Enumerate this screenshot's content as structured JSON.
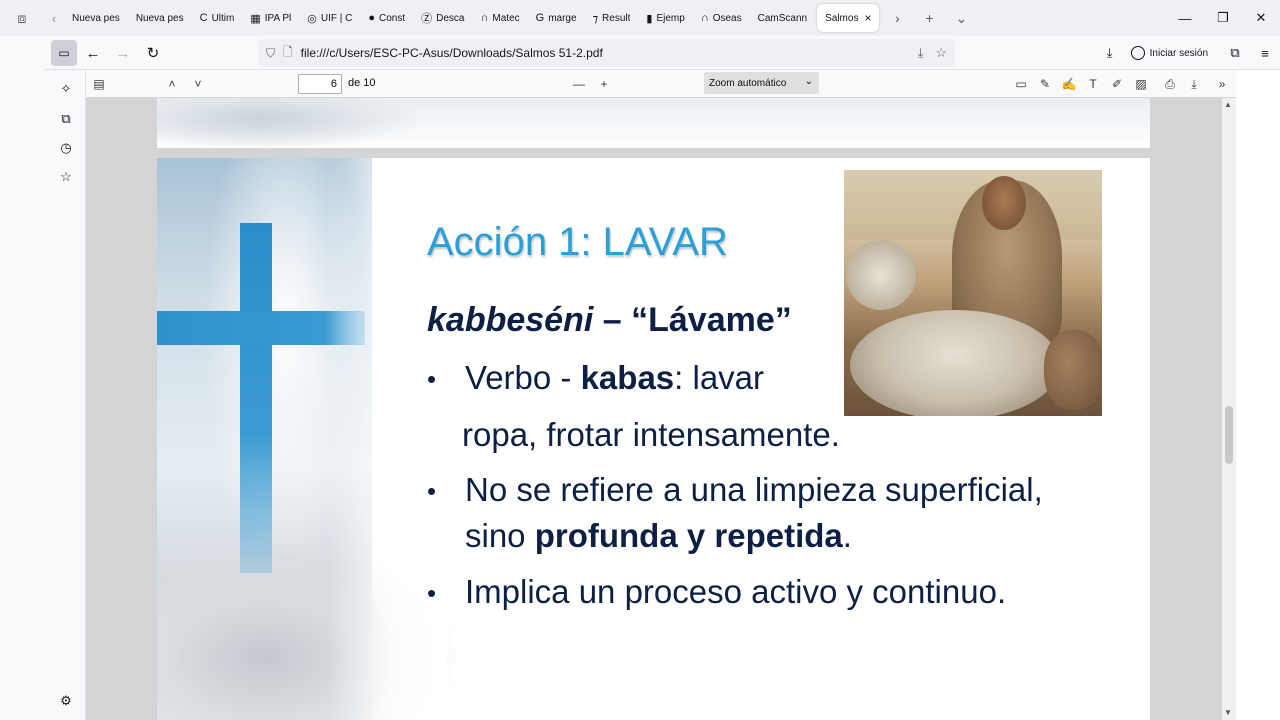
{
  "browser": {
    "tabs": [
      {
        "label": "Nueva pes",
        "icon": ""
      },
      {
        "label": "Nueva pes",
        "icon": ""
      },
      {
        "label": "Últim",
        "icon": "C"
      },
      {
        "label": "IPA Pl",
        "icon": "▦"
      },
      {
        "label": "UIF | C",
        "icon": "◎"
      },
      {
        "label": "Const",
        "icon": "●"
      },
      {
        "label": "Desca",
        "icon": "Ⓩ"
      },
      {
        "label": "Matec",
        "icon": "∩"
      },
      {
        "label": "marge",
        "icon": "G"
      },
      {
        "label": "Result",
        "icon": "⁊"
      },
      {
        "label": "Ejemp",
        "icon": "▮"
      },
      {
        "label": "Oseas",
        "icon": "∩"
      },
      {
        "label": "CamScann",
        "icon": ""
      }
    ],
    "active_tab": {
      "label": "Salmos",
      "close": "×"
    },
    "url": "file:///c/Users/ESC-PC-Asus/Downloads/Salmos 51-2.pdf",
    "signin_label": "Iniciar sesión",
    "icons": {
      "tab_tools": "⧈",
      "tab_prev": "‹",
      "tab_next": "›",
      "new_tab": "+",
      "tab_list": "⌄",
      "minimize": "—",
      "restore": "❐",
      "close": "✕",
      "sidebar_toggle": "▭",
      "back": "←",
      "forward": "→",
      "reload": "↻",
      "shield": "⛉",
      "page": "🗋",
      "install": "⤓",
      "bookmark": "☆",
      "downloads": "⤓",
      "extensions": "⧉",
      "menu": "≡"
    }
  },
  "sidebar": {
    "icons": {
      "ai": "✧",
      "sync": "⧉",
      "history": "◷",
      "bookmarks": "☆",
      "settings": "⚙"
    }
  },
  "pdf_toolbar": {
    "page_number": "6",
    "page_total": "de 10",
    "zoom": "Zoom automático",
    "icons": {
      "sidebar": "▤",
      "prev": "˄",
      "next": "˅",
      "zoom_out": "—",
      "zoom_in": "+",
      "comment": "▭",
      "signature": "✎",
      "highlight": "✍",
      "text": "T",
      "draw": "✐",
      "image": "▨",
      "print": "⎙",
      "save": "⤓",
      "more": "»",
      "chevron": "⌄"
    }
  },
  "slide": {
    "title": "Acción 1: LAVAR",
    "subtitle_italic": "kabbeséni",
    "subtitle_rest": " – “Lávame”",
    "bullets": [
      {
        "line1_pre": "Verbo - ",
        "line1_bold": "kabas",
        "line1_post": ": lavar",
        "line2": "ropa, frotar intensamente."
      },
      {
        "line1": "No se refiere a una limpieza superficial,",
        "line2_pre": "sino ",
        "line2_bold": "profunda y repetida",
        "line2_post": "."
      },
      {
        "line1": "Implica un proceso activo y continuo."
      }
    ],
    "bullet_char": "•"
  },
  "colors": {
    "title": "#2a9fd8",
    "text": "#0d1f45",
    "cross": "#2a8cc8"
  }
}
